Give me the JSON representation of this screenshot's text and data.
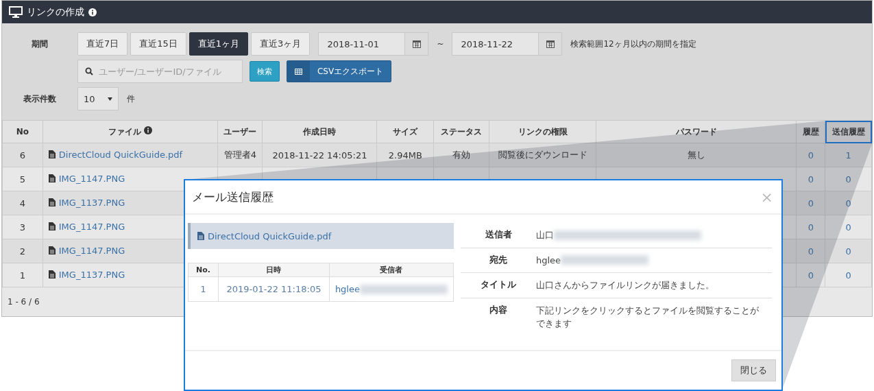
{
  "panel": {
    "title": "リンクの作成"
  },
  "filters": {
    "period_label": "期間",
    "period_buttons": [
      {
        "label": "直近7日",
        "selected": false
      },
      {
        "label": "直近15日",
        "selected": false
      },
      {
        "label": "直近1ヶ月",
        "selected": true
      },
      {
        "label": "直近3ヶ月",
        "selected": false
      }
    ],
    "date_from": "2018-11-01",
    "range_sep": "~",
    "date_to": "2018-11-22",
    "range_note": "検索範囲12ヶ月以内の期間を指定",
    "search": {
      "placeholder": "ユーザー/ユーザーID/ファイル"
    },
    "search_button": "検索",
    "export_button": "CSVエクスポート",
    "page_size_label": "表示件数",
    "page_size": "10",
    "page_size_unit": "件"
  },
  "table": {
    "columns": [
      {
        "label": "No",
        "highlighted": false
      },
      {
        "label": "ファイル",
        "highlighted": false
      },
      {
        "label": "ユーザー",
        "highlighted": false
      },
      {
        "label": "作成日時",
        "highlighted": false
      },
      {
        "label": "サイズ",
        "highlighted": false
      },
      {
        "label": "ステータス",
        "highlighted": false
      },
      {
        "label": "リンクの権限",
        "highlighted": false
      },
      {
        "label": "パスワード",
        "highlighted": false
      },
      {
        "label": "履歴",
        "highlighted": false
      },
      {
        "label": "送信履歴",
        "highlighted": true
      }
    ],
    "rows": [
      {
        "no": "6",
        "file": "DirectCloud QuickGuide.pdf",
        "user": "管理者4",
        "created": "2018-11-22 14:05:21",
        "size": "2.94MB",
        "status": "有効",
        "permission": "閲覧後にダウンロード",
        "password": "無し",
        "history": "0",
        "sent": "1"
      },
      {
        "no": "5",
        "file": "IMG_1147.PNG",
        "history": "0",
        "sent": "0"
      },
      {
        "no": "4",
        "file": "IMG_1137.PNG",
        "history": "0",
        "sent": "0"
      },
      {
        "no": "3",
        "file": "IMG_1147.PNG",
        "history": "0",
        "sent": "0"
      },
      {
        "no": "2",
        "file": "IMG_1147.PNG",
        "history": "0",
        "sent": "0"
      },
      {
        "no": "1",
        "file": "IMG_1137.PNG",
        "history": "0",
        "sent": "0"
      }
    ],
    "footer": "1 - 6 / 6"
  },
  "modal": {
    "title": "メール送信履歴",
    "close": "×",
    "file": "DirectCloud QuickGuide.pdf",
    "log_columns": [
      "No.",
      "日時",
      "受信者"
    ],
    "log_rows": [
      {
        "no": "1",
        "date": "2019-01-22 11:18:05",
        "recipient": "hglee"
      }
    ],
    "details": [
      {
        "label": "送信者",
        "value": "山口",
        "redacted": true
      },
      {
        "label": "宛先",
        "value": "hglee",
        "redacted": true
      },
      {
        "label": "タイトル",
        "value": "山口さんからファイルリンクが届きました。",
        "redacted": false
      },
      {
        "label": "内容",
        "value": "下記リンクをクリックするとファイルを閲覧することができます",
        "redacted": false
      }
    ],
    "close_button": "閉じる"
  }
}
